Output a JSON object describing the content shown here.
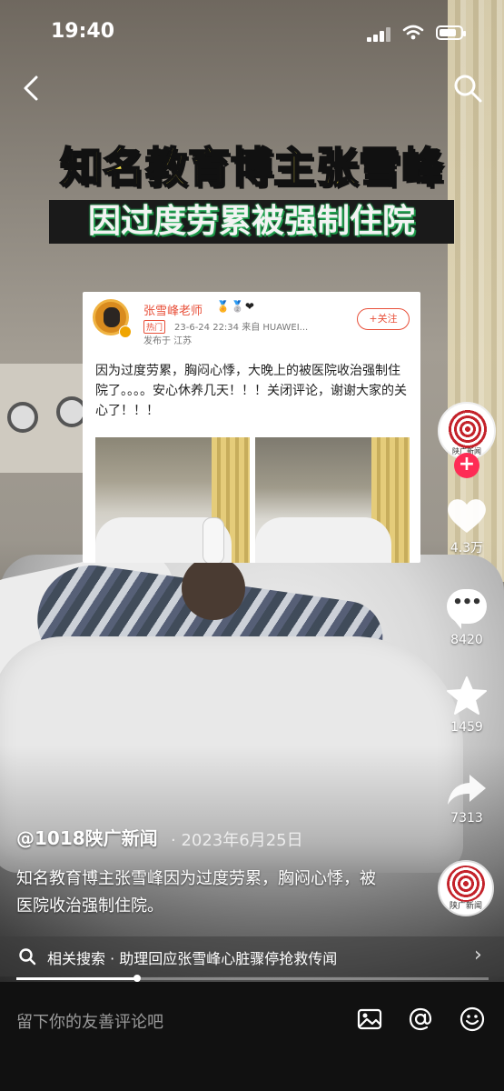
{
  "status_bar": {
    "time": "19:40"
  },
  "overlay": {
    "headline_line1": "知名教育博主张雪峰",
    "headline_line2": "因过度劳累被强制住院"
  },
  "weibo_card": {
    "user_name": "张雪峰老师",
    "medals": "🏅🥈❤",
    "hot_tag": "热门",
    "post_time": "23-6-24 22:34  来自 HUAWEI...",
    "location": "发布于 江苏",
    "follow_label": "+关注",
    "body": "因为过度劳累，胸闷心悸，大晚上的被医院收治强制住院了。。。。安心休养几天！！！关闭评论，谢谢大家的关心了！！！"
  },
  "actions": {
    "plus": "+",
    "likes": "4.3万",
    "comments": "8420",
    "favorites": "1459",
    "shares": "7313",
    "comment_bubble_glyph": "•••"
  },
  "account_badge": "陕广新闻",
  "post": {
    "author": "@1018陕广新闻",
    "date": "· 2023年6月25日",
    "description": "知名教育博主张雪峰因为过度劳累，胸闷心悸，被医院收治强制住院。"
  },
  "related_search": {
    "text": "相关搜索 · 助理回应张雪峰心脏骤停抢救传闻",
    "chevron": "›"
  },
  "video_progress": 0.255,
  "comment_bar": {
    "placeholder": "留下你的友善评论吧"
  },
  "icons": {
    "back": "chevron-left-icon",
    "search": "search-icon",
    "like": "heart-icon",
    "comment": "comment-bubble-icon",
    "favorite": "star-icon",
    "share": "share-arrow-icon",
    "image": "image-icon",
    "mention": "at-icon",
    "emoji": "smiley-icon"
  },
  "colors": {
    "headline_yellow": "#fde74c",
    "accent_red": "#fe2c55",
    "weibo_orange": "#e8503a"
  }
}
